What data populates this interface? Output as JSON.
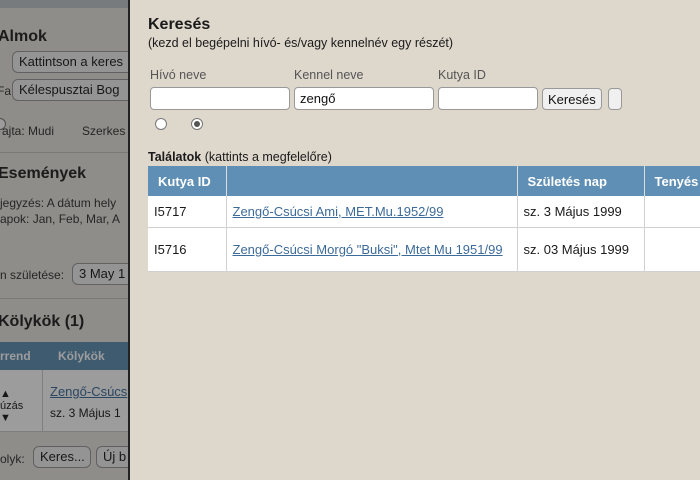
{
  "background": {
    "almok_heading": "Almok",
    "btn_kattintson": "Kattintson a keres",
    "fajta_label": "Fa:",
    "fajta_value": "Kélespusztai Bog",
    "fajta_info": "ajta: Mudi",
    "szerkes": "Szerkes",
    "esemenyek_heading": "Események",
    "jegyzes": "jegyzés: A dátum hely",
    "napok": "apok: Jan, Feb, Mar, A",
    "szuletese_label": "n születése:",
    "szuletese_value": "3 May 1",
    "kolykok_heading": "Kölykök (1)",
    "table_headers": [
      "rrend",
      "Kölykök"
    ],
    "row_link": "Zengő-Csúcs",
    "row_date": "sz. 3 Május 1",
    "row_move": "úzás",
    "bottom_label": "olyk:",
    "bottom_btn1": "Keres...",
    "bottom_btn2": "Új b"
  },
  "dialog": {
    "title": "Keresés",
    "subtitle": "(kezd el begépelni hívó- és/vagy kennelnév egy részét)",
    "fields": {
      "hivo": {
        "label": "Hívó neve",
        "value": ""
      },
      "kennel": {
        "label": "Kennel neve",
        "value": "zengő"
      },
      "kutya_id": {
        "label": "Kutya ID",
        "value": ""
      }
    },
    "search_button": "Keresés",
    "radio_selected_index": 1,
    "results_bold": "Találatok",
    "results_hint": " (kattints a megfelelőre)",
    "table": {
      "headers": [
        "Kutya ID",
        "",
        "Születés nap",
        "Tenyés"
      ],
      "rows": [
        {
          "id": "I5717",
          "name": "Zengő-Csúcsi Ami, MET.Mu.1952/99",
          "birth": "sz. 3 Május 1999",
          "extra": ""
        },
        {
          "id": "I5716",
          "name": "Zengő-Csúcsi Morgó \"Buksi\", Mtet Mu 1951/99",
          "birth": "sz. 03 Május 1999",
          "extra": ""
        }
      ]
    }
  },
  "colors": {
    "header_blue": "#5f8fb4",
    "link_blue": "#3d6b99",
    "panel_bg": "#ded7cc"
  }
}
